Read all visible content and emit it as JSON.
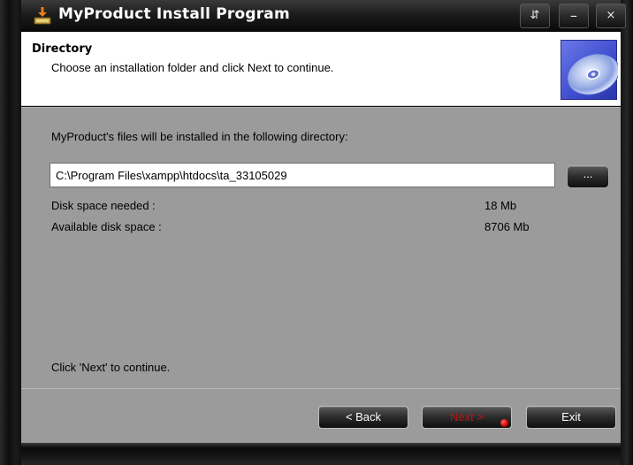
{
  "window": {
    "title": "MyProduct Install Program",
    "title_icon": "installer-icon",
    "controls": {
      "restore_label": "⇵",
      "minimize_label": "–",
      "close_label": "×"
    }
  },
  "header": {
    "title": "Directory",
    "subtitle": "Choose an installation folder and click Next to continue.",
    "graphic": "cd-disc-icon"
  },
  "body": {
    "intro": "MyProduct's files will be installed in the following directory:",
    "directory_value": "C:\\Program Files\\xampp\\htdocs\\ta_33105029",
    "browse_label": "...",
    "disk_needed_label": "Disk space needed :",
    "disk_needed_value": "18 Mb",
    "disk_available_label": "Available disk space :",
    "disk_available_value": "8706 Mb",
    "continue_hint": "Click 'Next' to continue."
  },
  "footer": {
    "back_label": "< Back",
    "next_label": "Next >",
    "exit_label": "Exit"
  },
  "colors": {
    "body_bg": "#9b9b9b",
    "header_bg": "#ffffff",
    "next_text": "#c21414",
    "accent_blue": "#3c4ccc"
  }
}
